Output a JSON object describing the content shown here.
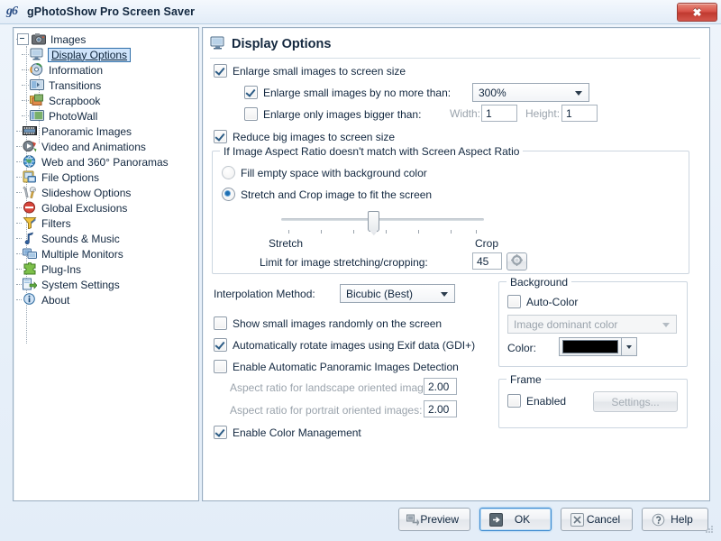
{
  "window": {
    "title": "gPhotoShow Pro Screen Saver",
    "logo_text": "g6",
    "close_label": "✖"
  },
  "sidebar": {
    "items": [
      {
        "label": "Images",
        "level": 0,
        "icon": "camera-icon",
        "expander": "minus",
        "selected": false
      },
      {
        "label": "Display Options",
        "level": 1,
        "icon": "monitor-icon",
        "expander": "none",
        "selected": true
      },
      {
        "label": "Information",
        "level": 1,
        "icon": "info-disc-icon",
        "expander": "none",
        "selected": false
      },
      {
        "label": "Transitions",
        "level": 1,
        "icon": "transitions-icon",
        "expander": "none",
        "selected": false
      },
      {
        "label": "Scrapbook",
        "level": 1,
        "icon": "scrapbook-icon",
        "expander": "none",
        "selected": false
      },
      {
        "label": "PhotoWall",
        "level": 1,
        "icon": "photowall-icon",
        "expander": "none",
        "selected": false
      },
      {
        "label": "Panoramic Images",
        "level": 0,
        "icon": "filmstrip-icon",
        "expander": "none",
        "selected": false
      },
      {
        "label": "Video and Animations",
        "level": 0,
        "icon": "video-icon",
        "expander": "none",
        "selected": false
      },
      {
        "label": "Web and 360° Panoramas",
        "level": 0,
        "icon": "globe-icon",
        "expander": "none",
        "selected": false
      },
      {
        "label": "File Options",
        "level": 0,
        "icon": "file-options-icon",
        "expander": "none",
        "selected": false
      },
      {
        "label": "Slideshow Options",
        "level": 0,
        "icon": "tools-icon",
        "expander": "none",
        "selected": false
      },
      {
        "label": "Global Exclusions",
        "level": 0,
        "icon": "no-entry-icon",
        "expander": "none",
        "selected": false
      },
      {
        "label": "Filters",
        "level": 0,
        "icon": "funnel-icon",
        "expander": "none",
        "selected": false
      },
      {
        "label": "Sounds & Music",
        "level": 0,
        "icon": "music-note-icon",
        "expander": "none",
        "selected": false
      },
      {
        "label": "Multiple Monitors",
        "level": 0,
        "icon": "monitors-icon",
        "expander": "none",
        "selected": false
      },
      {
        "label": "Plug-Ins",
        "level": 0,
        "icon": "puzzle-icon",
        "expander": "none",
        "selected": false
      },
      {
        "label": "System Settings",
        "level": 0,
        "icon": "system-settings-icon",
        "expander": "none",
        "selected": false
      },
      {
        "label": "About",
        "level": 0,
        "icon": "info-icon",
        "expander": "none",
        "selected": false
      }
    ]
  },
  "page": {
    "title": "Display Options",
    "enlarge_small": {
      "label": "Enlarge small images to screen size",
      "checked": true
    },
    "enlarge_by_no_more": {
      "label": "Enlarge small images by no more than:",
      "checked": true,
      "value": "300%"
    },
    "enlarge_only_bigger": {
      "label": "Enlarge only images bigger than:",
      "checked": false,
      "width_label": "Width:",
      "width_value": "1",
      "height_label": "Height:",
      "height_value": "1"
    },
    "reduce_big": {
      "label": "Reduce big images to screen size",
      "checked": true
    },
    "aspect_group": {
      "title": "If Image Aspect Ratio doesn't match with Screen Aspect Ratio",
      "option_fill": {
        "label": "Fill empty space with background color",
        "selected": false
      },
      "option_stretch": {
        "label": "Stretch and Crop image to fit the screen",
        "selected": true
      },
      "slider_left_label": "Stretch",
      "slider_right_label": "Crop",
      "slider_value": 45,
      "slider_min": 0,
      "slider_max": 100,
      "limit_label": "Limit for image stretching/cropping:",
      "limit_value": "45"
    },
    "interpolation": {
      "label": "Interpolation Method:",
      "value": "Bicubic (Best)"
    },
    "show_random": {
      "label": "Show small images randomly on the screen",
      "checked": false
    },
    "auto_rotate": {
      "label": "Automatically rotate images using Exif data (GDI+)",
      "checked": true
    },
    "panoramic_detect": {
      "label": "Enable Automatic Panoramic Images Detection",
      "checked": false
    },
    "aspect_landscape": {
      "label": "Aspect ratio for landscape oriented images:",
      "value": "2.00"
    },
    "aspect_portrait": {
      "label": "Aspect ratio for portrait oriented images:",
      "value": "2.00"
    },
    "color_management": {
      "label": "Enable Color Management",
      "checked": true
    },
    "background_group": {
      "title": "Background",
      "auto_color": {
        "label": "Auto-Color",
        "checked": false
      },
      "dominant_combo": "Image dominant color",
      "color_label": "Color:",
      "color_value": "#000000"
    },
    "frame_group": {
      "title": "Frame",
      "enabled": {
        "label": "Enabled",
        "checked": false
      },
      "settings_button": "Settings..."
    }
  },
  "footer": {
    "preview": "Preview",
    "ok": "OK",
    "cancel": "Cancel",
    "help": "Help"
  }
}
